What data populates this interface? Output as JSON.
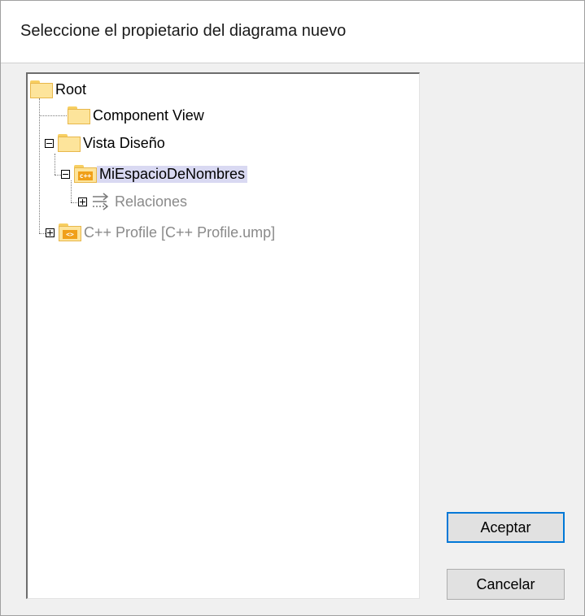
{
  "dialog": {
    "title": "Seleccione el propietario del diagrama nuevo"
  },
  "tree": {
    "root": {
      "label": "Root",
      "icon": "folder-icon"
    },
    "component_view": {
      "label": "Component View",
      "icon": "folder-icon"
    },
    "vista_diseno": {
      "label": "Vista Diseño",
      "icon": "folder-icon",
      "expanded": true
    },
    "mi_espacio": {
      "label": "MiEspacioDeNombres",
      "icon": "cpp-namespace-folder-icon",
      "badge": "c++",
      "expanded": true,
      "selected": true
    },
    "relaciones": {
      "label": "Relaciones",
      "icon": "relations-icon",
      "expanded": false
    },
    "cpp_profile": {
      "label": "C++ Profile [C++ Profile.ump]",
      "icon": "profile-folder-icon",
      "badge": "<>",
      "expanded": false
    }
  },
  "buttons": {
    "ok_label": "Aceptar",
    "cancel_label": "Cancelar"
  },
  "colors": {
    "selection": "#d9d9f2",
    "folder": "#fde49b",
    "default_button_border": "#0078d7"
  }
}
